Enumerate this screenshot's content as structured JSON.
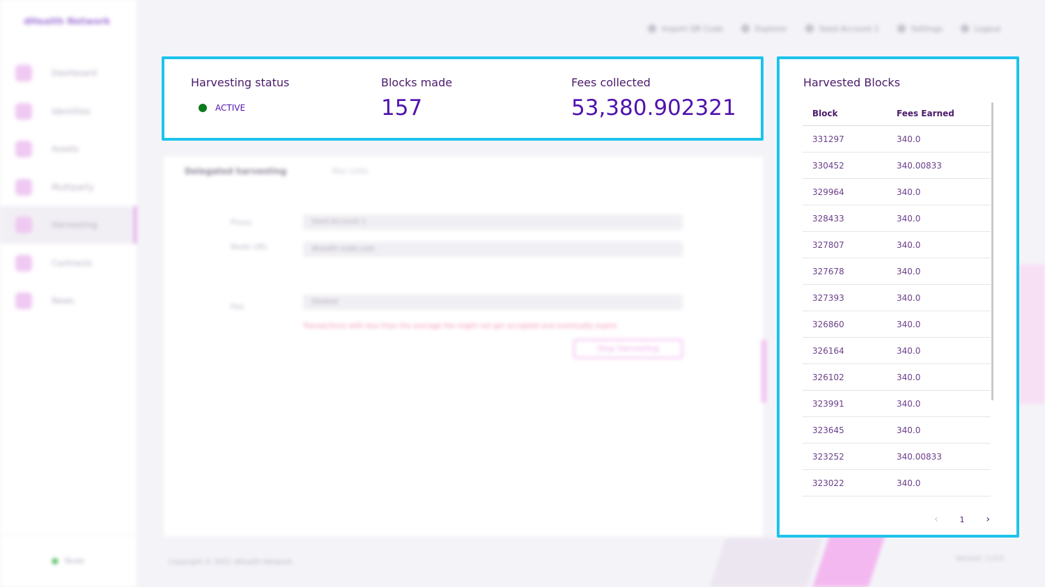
{
  "brand": "dHealth Network",
  "sidebar": {
    "items": [
      {
        "label": "Dashboard",
        "icon": "dashboard-icon"
      },
      {
        "label": "Identities",
        "icon": "identities-icon"
      },
      {
        "label": "Assets",
        "icon": "assets-icon"
      },
      {
        "label": "Multiparty",
        "icon": "multiparty-icon"
      },
      {
        "label": "Harvesting",
        "icon": "harvesting-icon",
        "active": true
      },
      {
        "label": "Contracts",
        "icon": "contracts-icon"
      },
      {
        "label": "News",
        "icon": "news-icon"
      }
    ],
    "node_status": "Node"
  },
  "topbar": {
    "import_qr": "Import QR Code",
    "explorer": "Explorer",
    "account": "Seed Account 1",
    "settings": "Settings",
    "logout": "Logout"
  },
  "stats": {
    "status_title": "Harvesting status",
    "status_value": "ACTIVE",
    "blocks_title": "Blocks made",
    "blocks_value": "157",
    "fees_title": "Fees collected",
    "fees_value": "53,380.902321"
  },
  "form": {
    "tab_active": "Delegated harvesting",
    "tab_other": "Key Links",
    "proxy_label": "Proxy",
    "proxy_value": "Seed Account 1",
    "node_label": "Node URL",
    "node_value": "dhealth-node.com",
    "fee_label": "Fee",
    "fee_value": "Slowest",
    "warning": "Transactions with less than the average fee might not get accepted and eventually expire",
    "stop_button": "Stop Harvesting"
  },
  "harvested": {
    "title": "Harvested Blocks",
    "col_block": "Block",
    "col_fees": "Fees Earned",
    "rows": [
      {
        "block": "331297",
        "fee": "340.0"
      },
      {
        "block": "330452",
        "fee": "340.00833"
      },
      {
        "block": "329964",
        "fee": "340.0"
      },
      {
        "block": "328433",
        "fee": "340.0"
      },
      {
        "block": "327807",
        "fee": "340.0"
      },
      {
        "block": "327678",
        "fee": "340.0"
      },
      {
        "block": "327393",
        "fee": "340.0"
      },
      {
        "block": "326860",
        "fee": "340.0"
      },
      {
        "block": "326164",
        "fee": "340.0"
      },
      {
        "block": "326102",
        "fee": "340.0"
      },
      {
        "block": "323991",
        "fee": "340.0"
      },
      {
        "block": "323645",
        "fee": "340.0"
      },
      {
        "block": "323252",
        "fee": "340.00833"
      },
      {
        "block": "323022",
        "fee": "340.0"
      }
    ],
    "page": "1"
  },
  "footer": {
    "copyright": "Copyright © 2021 dHealth Network",
    "version": "Version: 1.0.0"
  },
  "colors": {
    "highlight_border": "#1cc3ec",
    "accent": "#5012ad",
    "active_dot": "#0d7a1e"
  }
}
